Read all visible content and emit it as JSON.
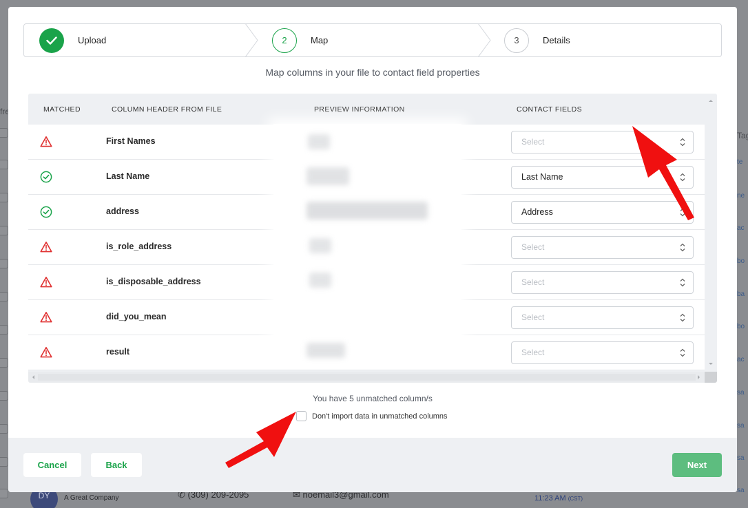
{
  "stepper": {
    "steps": [
      {
        "label": "Upload",
        "number": "",
        "state": "done"
      },
      {
        "label": "Map",
        "number": "2",
        "state": "active"
      },
      {
        "label": "Details",
        "number": "3",
        "state": "todo"
      }
    ]
  },
  "subtitle": "Map columns in your file to contact field properties",
  "table": {
    "headers": {
      "matched": "MATCHED",
      "column_header": "COLUMN HEADER FROM FILE",
      "preview": "PREVIEW INFORMATION",
      "contact_fields": "CONTACT FIELDS"
    },
    "rows": [
      {
        "status": "warning",
        "column": "First Names",
        "field": "Select",
        "selected": false
      },
      {
        "status": "matched",
        "column": "Last Name",
        "field": "Last Name",
        "selected": true
      },
      {
        "status": "matched",
        "column": "address",
        "field": "Address",
        "selected": true
      },
      {
        "status": "warning",
        "column": "is_role_address",
        "field": "Select",
        "selected": false
      },
      {
        "status": "warning",
        "column": "is_disposable_address",
        "field": "Select",
        "selected": false
      },
      {
        "status": "warning",
        "column": "did_you_mean",
        "field": "Select",
        "selected": false
      },
      {
        "status": "warning",
        "column": "result",
        "field": "Select",
        "selected": false
      }
    ]
  },
  "unmatched_text": "You have 5 unmatched column/s",
  "skip_unmatched_label": "Don't import data in unmatched columns",
  "footer": {
    "cancel": "Cancel",
    "back": "Back",
    "next": "Next"
  },
  "background": {
    "left_text": "fre",
    "right_title": "Tag",
    "right_items": [
      "te",
      "ne",
      "ac",
      "bo",
      "ba",
      "bo",
      "ac",
      "sa",
      "sa",
      "sa",
      "sa"
    ],
    "avatar_initials": "DY",
    "company": "A Great Company",
    "phone": "(309) 209-2095",
    "email": "noemail3@gmail.com",
    "time": "11:23 AM",
    "timezone": "(CST)"
  },
  "colors": {
    "green": "#1aa34a",
    "warning_red": "#e03131",
    "next_button": "#5dbd7f",
    "annotation_arrow": "#f01010"
  }
}
